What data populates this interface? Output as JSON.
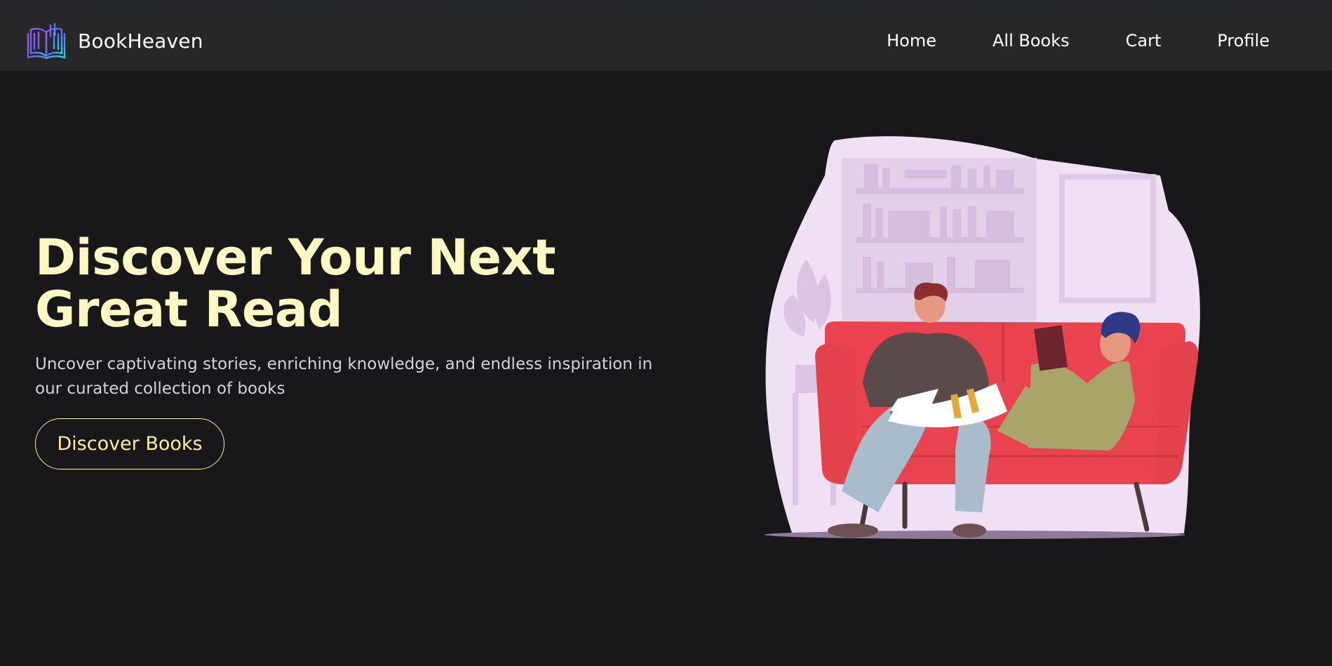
{
  "navbar": {
    "brand_name": "BookHeaven",
    "logo_icon": "open-book-icon",
    "links": [
      {
        "label": "Home"
      },
      {
        "label": "All Books"
      },
      {
        "label": "Cart"
      },
      {
        "label": "Profile"
      }
    ]
  },
  "hero": {
    "title": "Discover Your Next Great Read",
    "subtitle": "Uncover captivating stories, enriching knowledge, and endless inspiration in our curated collection of books",
    "cta_label": "Discover Books",
    "illustration": "couple-reading-on-sofa-illustration"
  },
  "colors": {
    "background": "#18181b",
    "navbar": "#27272a",
    "title": "#fef9c3",
    "accent": "#fef08a",
    "subtitle": "#d4d4d8",
    "sofa": "#e9434f",
    "backdrop": "#efe1f3"
  }
}
